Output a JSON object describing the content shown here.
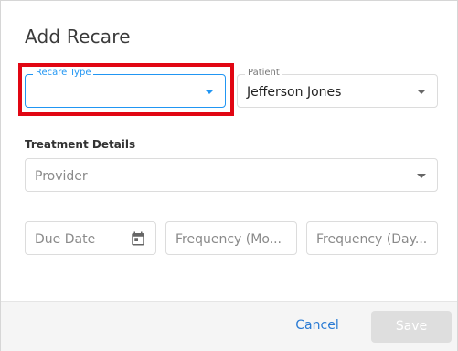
{
  "dialog": {
    "title": "Add Recare",
    "recare_type": {
      "label": "Recare Type",
      "value": ""
    },
    "patient": {
      "label": "Patient",
      "value": "Jefferson Jones"
    },
    "treatment_details_label": "Treatment Details",
    "provider": {
      "placeholder": "Provider"
    },
    "due_date": {
      "placeholder": "Due Date"
    },
    "frequency_months": {
      "placeholder": "Frequency (Mo..."
    },
    "frequency_days": {
      "placeholder": "Frequency (Day..."
    }
  },
  "footer": {
    "cancel_label": "Cancel",
    "save_label": "Save"
  },
  "colors": {
    "accent": "#2196f3",
    "highlight": "#e10613",
    "link": "#2a7bd4",
    "disabled": "#dedede"
  }
}
